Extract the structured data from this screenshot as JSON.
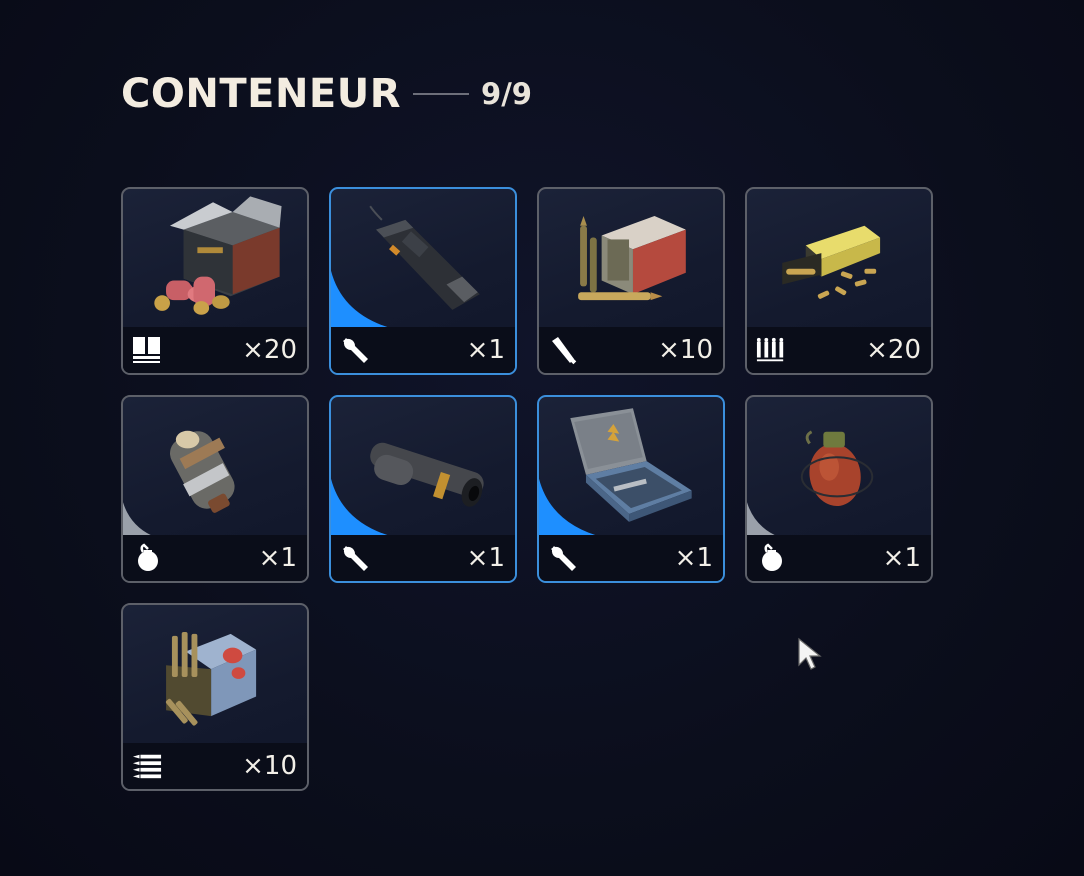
{
  "container": {
    "title": "CONTENEUR",
    "count": "9/9"
  },
  "colors": {
    "accent_blue": "#1e8fff",
    "selected_border": "#3b8fdc",
    "grey_corner": "#9aa0aa"
  },
  "items": [
    {
      "name": "shotgun-shells-box",
      "category_icon": "shotgun-shells-icon",
      "quantity": "×20",
      "selected": false,
      "corner": "none"
    },
    {
      "name": "walkie-talkie",
      "category_icon": "wrench-icon",
      "quantity": "×1",
      "selected": true,
      "corner": "blue"
    },
    {
      "name": "rifle-ammo-box",
      "category_icon": "bullet-icon",
      "quantity": "×10",
      "selected": false,
      "corner": "none"
    },
    {
      "name": "pistol-ammo-box",
      "category_icon": "pistol-ammo-icon",
      "quantity": "×20",
      "selected": false,
      "corner": "none"
    },
    {
      "name": "pipe-bomb",
      "category_icon": "throwable-icon",
      "quantity": "×1",
      "selected": false,
      "corner": "grey"
    },
    {
      "name": "suppressor",
      "category_icon": "wrench-icon",
      "quantity": "×1",
      "selected": true,
      "corner": "blue"
    },
    {
      "name": "tool-case",
      "category_icon": "wrench-icon",
      "quantity": "×1",
      "selected": true,
      "corner": "blue"
    },
    {
      "name": "frag-grenade",
      "category_icon": "throwable-icon",
      "quantity": "×1",
      "selected": false,
      "corner": "grey"
    },
    {
      "name": "sniper-ammo-box",
      "category_icon": "rifle-ammo-icon",
      "quantity": "×10",
      "selected": false,
      "corner": "none"
    }
  ]
}
